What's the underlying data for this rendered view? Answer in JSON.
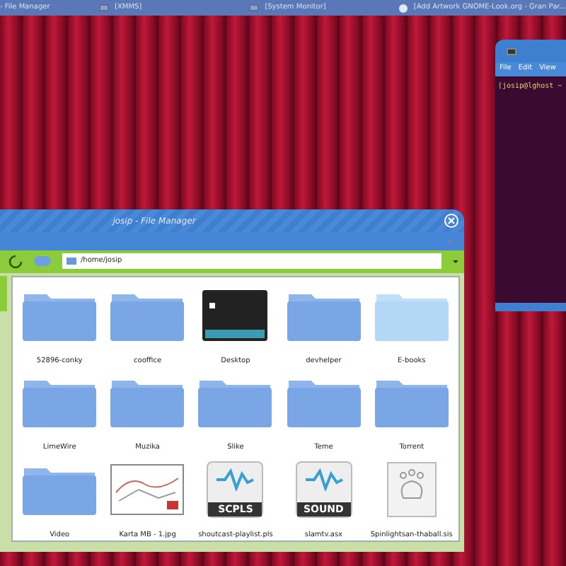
{
  "taskbar": {
    "items": [
      {
        "label": "- File Manager",
        "kind": "text"
      },
      {
        "label": "[XMMS]",
        "kind": "icon"
      },
      {
        "label": "[System Monitor]",
        "kind": "icon"
      },
      {
        "label": "[Add Artwork GNOME-Look.org - Gran Par...",
        "kind": "globe"
      }
    ]
  },
  "terminal": {
    "menu": [
      "File",
      "Edit",
      "View"
    ],
    "prompt": "[josip@lghost ~"
  },
  "file_manager": {
    "title": "josip - File Manager",
    "location": "/home/josip",
    "files": [
      {
        "name": "52896-conky",
        "kind": "folder"
      },
      {
        "name": "cooffice",
        "kind": "folder"
      },
      {
        "name": "Desktop",
        "kind": "desktop"
      },
      {
        "name": "devhelper",
        "kind": "folder"
      },
      {
        "name": "E-books",
        "kind": "folder-light"
      },
      {
        "name": "LimeWire",
        "kind": "folder"
      },
      {
        "name": "Muzika",
        "kind": "folder"
      },
      {
        "name": "Slike",
        "kind": "folder"
      },
      {
        "name": "Teme",
        "kind": "folder"
      },
      {
        "name": "Torrent",
        "kind": "folder"
      },
      {
        "name": "Video",
        "kind": "folder"
      },
      {
        "name": "Karta MB - 1.jpg",
        "kind": "image"
      },
      {
        "name": "shoutcast-playlist.pls",
        "kind": "audio",
        "badge": "SCPLS"
      },
      {
        "name": "slamtv.asx",
        "kind": "audio",
        "badge": "SOUND"
      },
      {
        "name": "Spinlightsan-thaball.sis",
        "kind": "generic"
      }
    ]
  }
}
